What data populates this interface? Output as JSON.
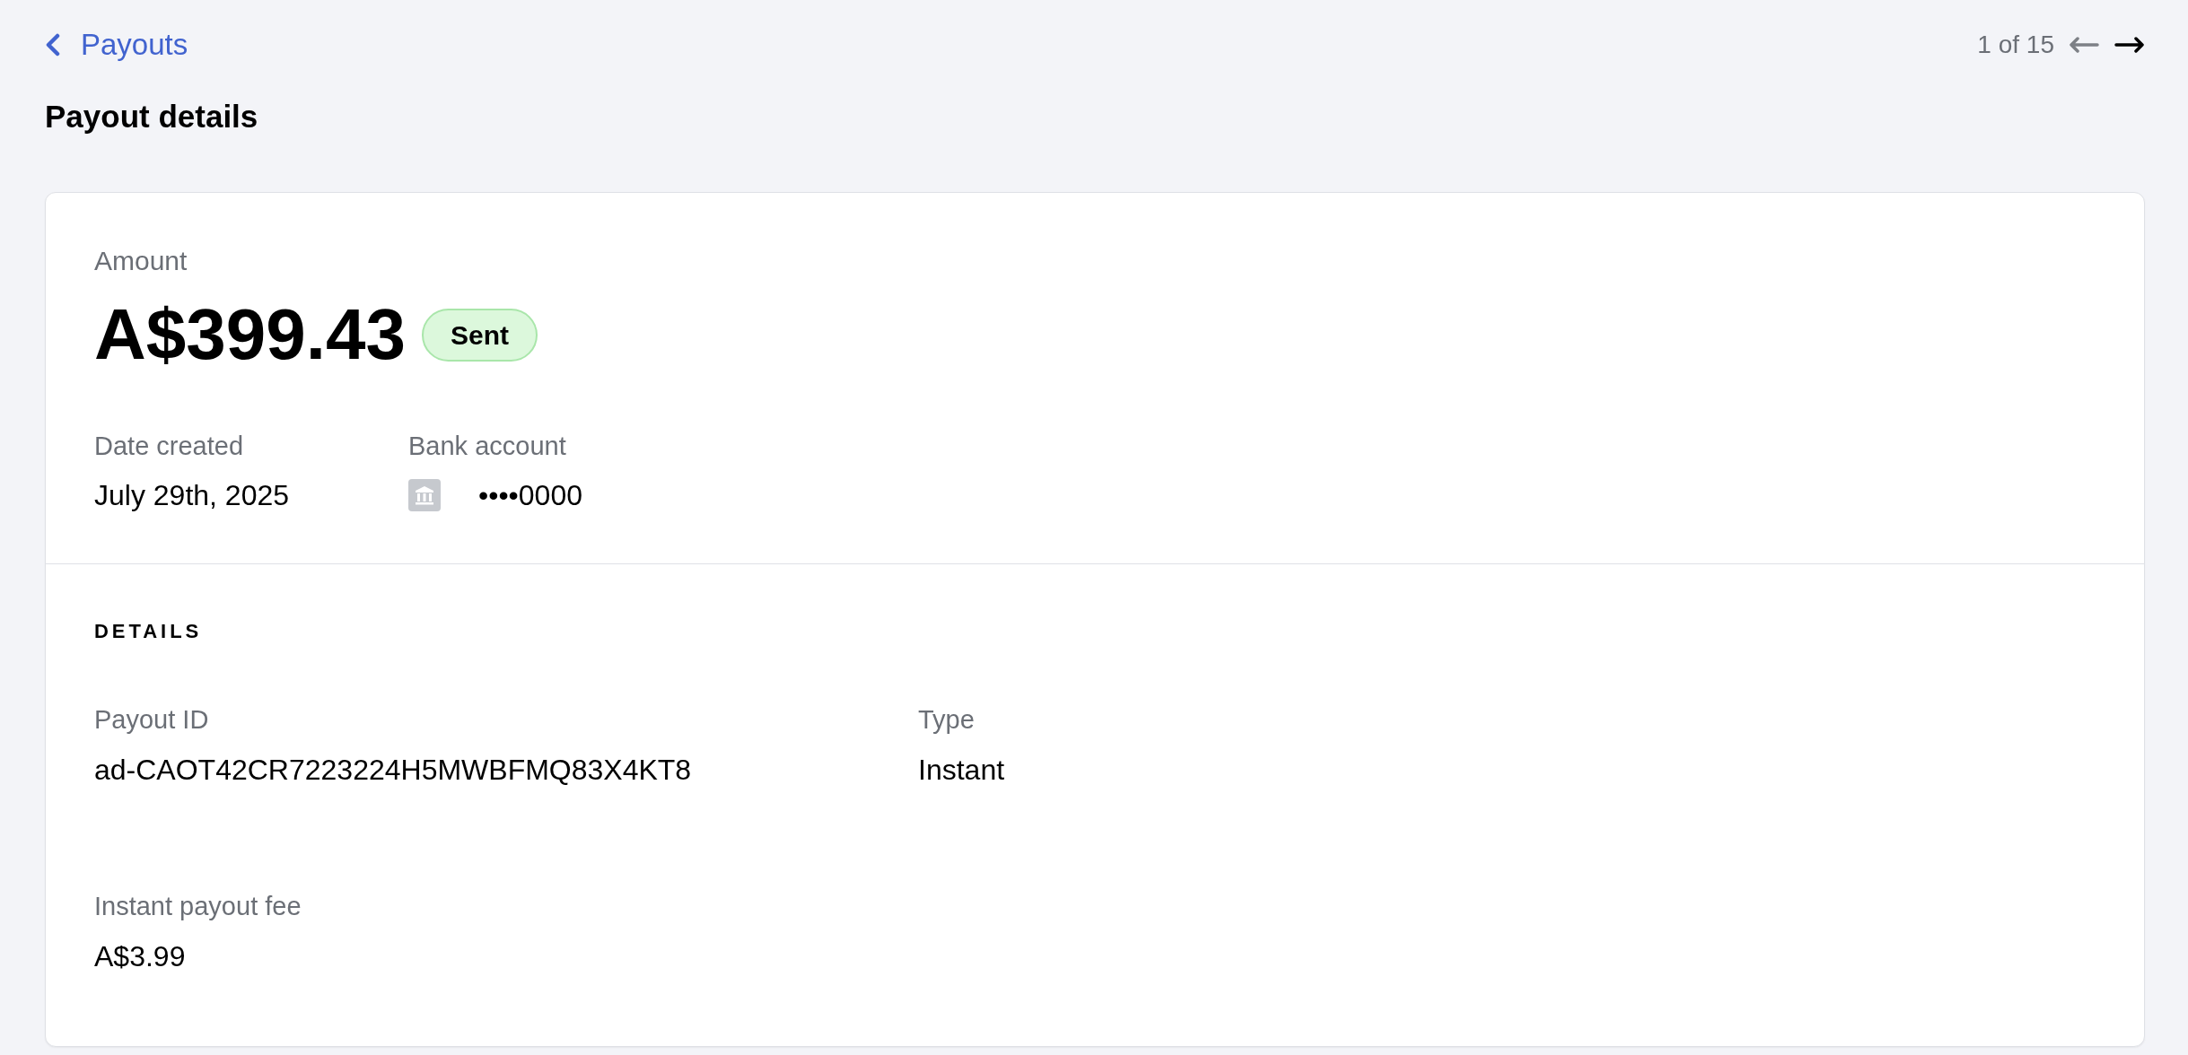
{
  "back_link": {
    "label": "Payouts"
  },
  "pagination": {
    "text": "1 of 15",
    "previous": {
      "disabled": true
    },
    "next": {
      "disabled": false
    }
  },
  "title": "Payout details",
  "summary": {
    "amount_label": "Amount",
    "amount": "A$399.43",
    "status": {
      "label": "Sent",
      "kind": "success"
    },
    "fields": [
      {
        "label": "Date created",
        "value": "July 29th, 2025",
        "kind": "text"
      },
      {
        "label": "Bank account",
        "value": "••••0000",
        "kind": "bank"
      }
    ]
  },
  "details": {
    "heading": "DETAILS",
    "fields": [
      {
        "label": "Payout ID",
        "value": "ad-CAOT42CR7223224H5MWBFMQ83X4KT8"
      },
      {
        "label": "Type",
        "value": "Instant"
      },
      {
        "label": "Instant payout fee",
        "value": "A$3.99"
      }
    ]
  }
}
